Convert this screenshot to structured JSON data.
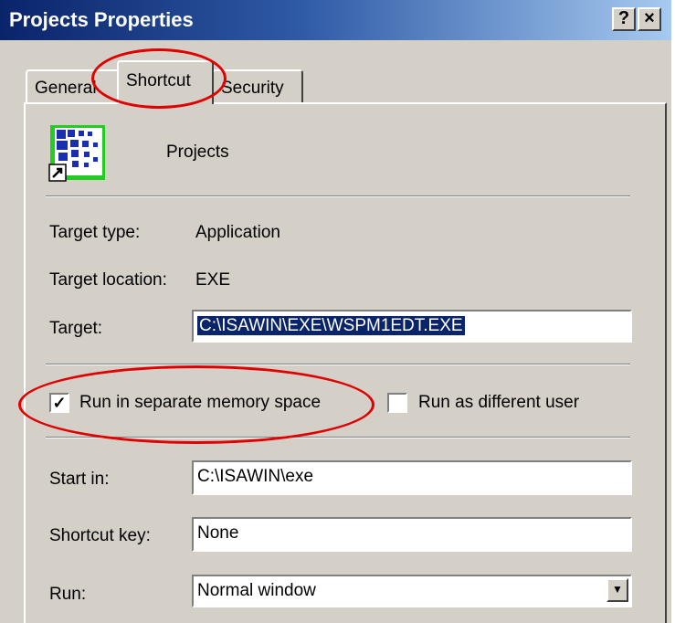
{
  "window": {
    "title": "Projects Properties",
    "help_label": "?",
    "close_label": "×"
  },
  "tabs": [
    {
      "label": "General",
      "selected": false
    },
    {
      "label": "Shortcut",
      "selected": true
    },
    {
      "label": "Security",
      "selected": false
    }
  ],
  "shortcut": {
    "name": "Projects",
    "icon": "application-shortcut-icon",
    "target_type_label": "Target type:",
    "target_type_value": "Application",
    "target_location_label": "Target location:",
    "target_location_value": "EXE",
    "target_label": "Target:",
    "target_value": "C:\\ISAWIN\\EXE\\WSPM1EDT.EXE",
    "run_separate_label": "Run in separate memory space",
    "run_separate_checked": true,
    "run_separate_mark": "✓",
    "run_different_user_label": "Run as different user",
    "run_different_user_checked": false,
    "start_in_label": "Start in:",
    "start_in_value": "C:\\ISAWIN\\exe",
    "shortcut_key_label": "Shortcut key:",
    "shortcut_key_value": "None",
    "run_label": "Run:",
    "run_value": "Normal window"
  },
  "colors": {
    "title_gradient_start": "#0a246a",
    "title_gradient_end": "#a6caf0",
    "dialog_face": "#d4d0c8",
    "selection": "#0a246a",
    "annotation_red": "#e00000"
  }
}
